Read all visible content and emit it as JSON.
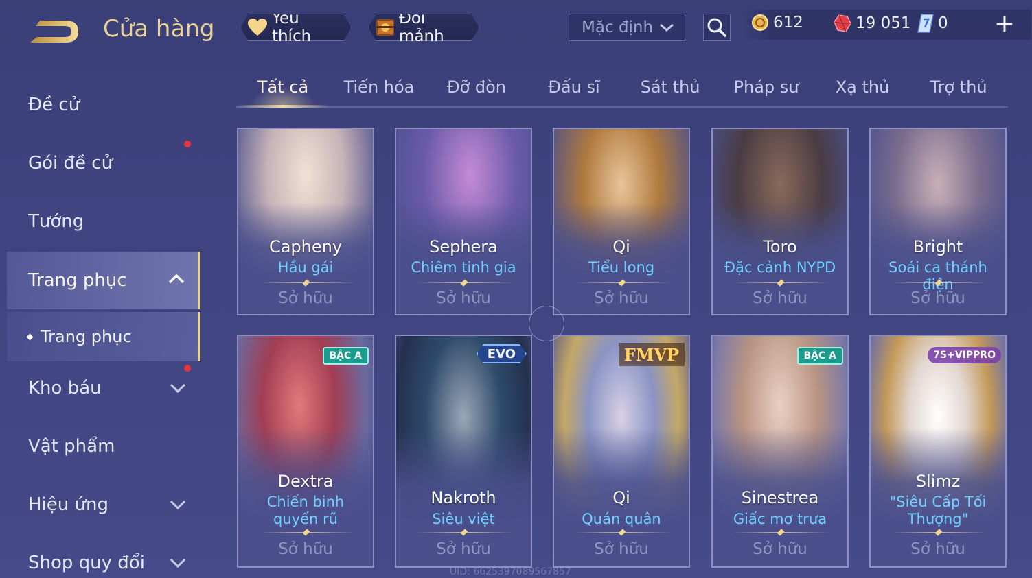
{
  "header": {
    "title": "Cửa hàng",
    "favorites_label": "Yêu thích",
    "exchange_label": "Đổi mảnh",
    "sort_value": "Mặc định",
    "currency": {
      "gold": "612",
      "ruby": "19 051",
      "voucher": "0"
    },
    "add_label": "+"
  },
  "sidebar": {
    "items": [
      {
        "label": "Đề cử"
      },
      {
        "label": "Gói đề cử"
      },
      {
        "label": "Tướng"
      },
      {
        "label": "Trang phục"
      },
      {
        "label": "Trang phục"
      },
      {
        "label": "Kho báu"
      },
      {
        "label": "Vật phẩm"
      },
      {
        "label": "Hiệu ứng"
      },
      {
        "label": "Shop quy đổi"
      }
    ]
  },
  "tabs": [
    {
      "label": "Tất cả"
    },
    {
      "label": "Tiến hóa"
    },
    {
      "label": "Đỡ đòn"
    },
    {
      "label": "Đấu sĩ"
    },
    {
      "label": "Sát thủ"
    },
    {
      "label": "Pháp sư"
    },
    {
      "label": "Xạ thủ"
    },
    {
      "label": "Trợ thủ"
    }
  ],
  "cards": [
    {
      "hero": "Capheny",
      "skin": "Hầu gái",
      "status": "Sở hữu",
      "badge": "",
      "art_color": "#d9c3b8"
    },
    {
      "hero": "Sephera",
      "skin": "Chiêm tinh gia",
      "status": "Sở hữu",
      "badge": "",
      "art_color": "#6b5aa6"
    },
    {
      "hero": "Qi",
      "skin": "Tiểu long",
      "status": "Sở hữu",
      "badge": "",
      "art_color": "#c08a4a"
    },
    {
      "hero": "Toro",
      "skin": "Đặc cảnh NYPD",
      "status": "Sở hữu",
      "badge": "",
      "art_color": "#5a4a4a"
    },
    {
      "hero": "Bright",
      "skin": "Soái ca thánh điện",
      "status": "Sở hữu",
      "badge": "",
      "art_color": "#8a7a9a"
    },
    {
      "hero": "Dextra",
      "skin": "Chiến binh quyến rũ",
      "status": "Sở hữu",
      "badge": "BẬC A",
      "art_color": "#b64a5a"
    },
    {
      "hero": "Nakroth",
      "skin": "Siêu việt",
      "status": "Sở hữu",
      "badge": "EVO",
      "art_color": "#2f4a6a"
    },
    {
      "hero": "Qi",
      "skin": "Quán quân",
      "status": "Sở hữu",
      "badge": "FMVP",
      "art_color": "#c8b27a"
    },
    {
      "hero": "Sinestrea",
      "skin": "Giấc mơ trưa",
      "status": "Sở hữu",
      "badge": "BẬC A",
      "art_color": "#b89a86"
    },
    {
      "hero": "Slimz",
      "skin": "\"Siêu Cấp Tối Thượng\"",
      "status": "Sở hữu",
      "badge": "7S+VIPPRO",
      "art_color": "#e2d2c8"
    }
  ],
  "footer": {
    "uid": "UID: 6625397089567857"
  }
}
